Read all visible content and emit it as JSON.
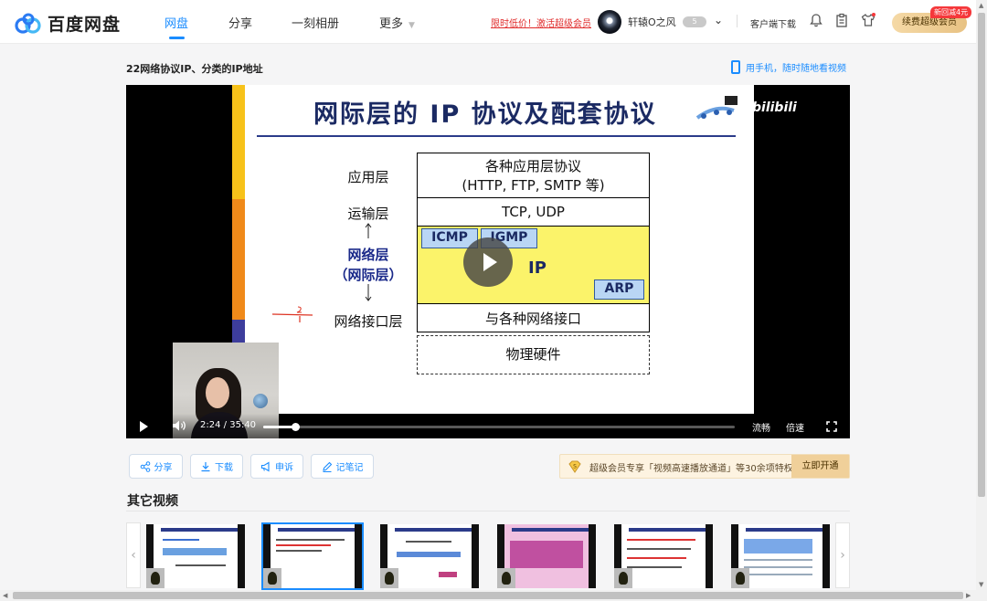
{
  "header": {
    "logo_text": "百度网盘",
    "nav": [
      {
        "label": "网盘",
        "active": true
      },
      {
        "label": "分享",
        "active": false
      },
      {
        "label": "一刻相册",
        "active": false
      },
      {
        "label": "更多",
        "active": false
      }
    ],
    "promo_link": "限时低价！激活超级会员",
    "username": "轩辕O之风",
    "user_badge": "5",
    "client_download": "客户端下载",
    "renew_button": "续费超级会员",
    "renew_tag": "新回减4元"
  },
  "video": {
    "title": "22网络协议IP、分类的IP地址",
    "mobile_link": "用手机，随时随地看视频",
    "current_time": "2:24",
    "time_separator": "/",
    "duration": "35:40",
    "progress": 0.0673,
    "quality": "流畅",
    "speed": "倍速"
  },
  "slide": {
    "title": "网际层的 IP 协议及配套协议",
    "watermark": "bilibili",
    "layers": {
      "app": "应用层",
      "transport": "运输层",
      "network": "网络层",
      "network_sub": "（网际层）",
      "link": "网络接口层"
    },
    "cells": {
      "app_line1": "各种应用层协议",
      "app_line2": "(HTTP, FTP, SMTP 等)",
      "transport": "TCP, UDP",
      "icmp": "ICMP",
      "igmp": "IGMP",
      "ip": "IP",
      "arp": "ARP",
      "link": "与各种网络接口",
      "hardware": "物理硬件"
    },
    "handwritten": "2 / 1"
  },
  "actions": {
    "share": "分享",
    "download": "下载",
    "report": "申诉",
    "notes": "记笔记"
  },
  "vip_bar": {
    "text": "超级会员专享「视频高速播放通道」等30余项特权",
    "button": "立即开通"
  },
  "other_videos": {
    "heading": "其它视频",
    "active_index": 1,
    "count": 6
  },
  "colors": {
    "brand_blue": "#1a8cff",
    "promo_red": "#e02b2b",
    "vip_gold": "#f0d09a",
    "slide_navy": "#1b2a63",
    "ip_yellow": "#fbf36a"
  }
}
